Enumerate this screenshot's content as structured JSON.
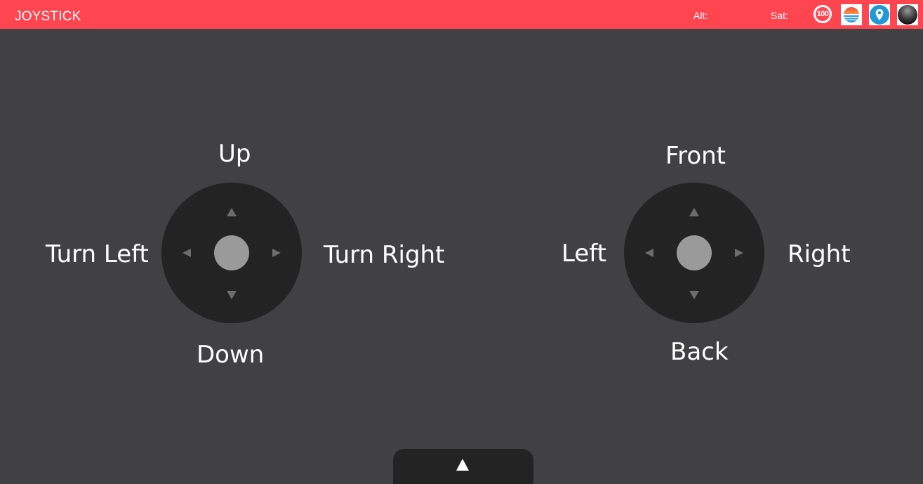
{
  "header": {
    "title": "JOYSTICK",
    "alt_label": "Alt:",
    "sat_label": "Sat:",
    "battery_value": "100",
    "accent_color": "#ff4550",
    "icons": [
      "battery-icon",
      "weather-icon",
      "location-icon",
      "status-icon"
    ]
  },
  "left_joystick": {
    "up": "Up",
    "down": "Down",
    "left": "Turn Left",
    "right": "Turn Right"
  },
  "right_joystick": {
    "up": "Front",
    "down": "Back",
    "left": "Left",
    "right": "Right"
  },
  "bottom_panel": {
    "icon": "expand-up-icon"
  },
  "colors": {
    "background": "#414143",
    "pad": "#232323",
    "knob": "#9a9a9a",
    "arrow": "#6d6d6d"
  }
}
